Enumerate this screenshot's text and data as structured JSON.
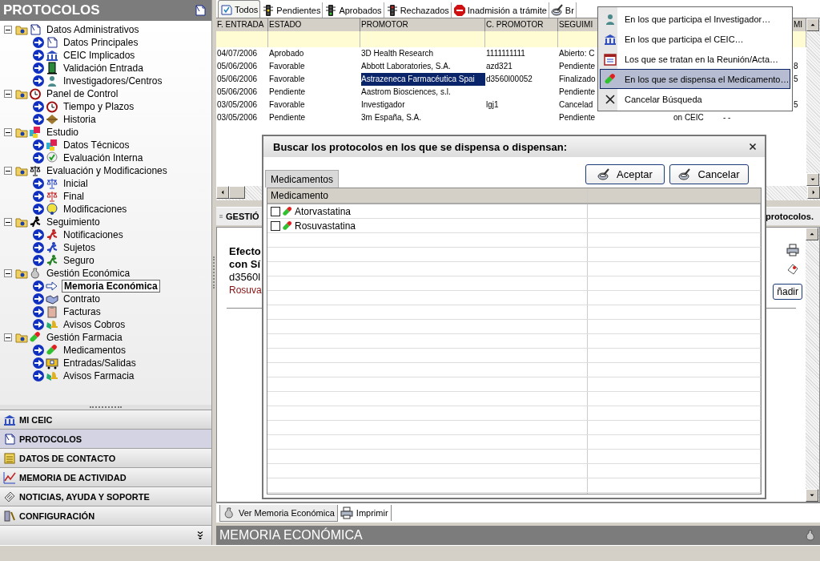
{
  "sidebar": {
    "title": "PROTOCOLOS",
    "tree": [
      {
        "label": "Datos Administrativos",
        "expanded": true,
        "children": [
          {
            "label": "Datos Principales",
            "selected": false
          },
          {
            "label": "CEIC Implicados",
            "selected": false
          },
          {
            "label": "Validación Entrada",
            "selected": false
          },
          {
            "label": "Investigadores/Centros",
            "selected": false
          }
        ]
      },
      {
        "label": "Panel de Control",
        "expanded": true,
        "children": [
          {
            "label": "Tiempo y Plazos",
            "selected": false
          },
          {
            "label": "Historia",
            "selected": false
          }
        ]
      },
      {
        "label": "Estudio",
        "expanded": true,
        "children": [
          {
            "label": "Datos Técnicos",
            "selected": false
          },
          {
            "label": "Evaluación Interna",
            "selected": false
          }
        ]
      },
      {
        "label": "Evaluación y Modificaciones",
        "expanded": true,
        "children": [
          {
            "label": "Inicial",
            "selected": false
          },
          {
            "label": "Final",
            "selected": false
          },
          {
            "label": "Modificaciones",
            "selected": false
          }
        ]
      },
      {
        "label": "Seguimiento",
        "expanded": true,
        "children": [
          {
            "label": "Notificaciones",
            "selected": false
          },
          {
            "label": "Sujetos",
            "selected": false
          },
          {
            "label": "Seguro",
            "selected": false
          }
        ]
      },
      {
        "label": "Gestión Económica",
        "expanded": true,
        "children": [
          {
            "label": "Memoria Económica",
            "selected": true
          },
          {
            "label": "Contrato",
            "selected": false
          },
          {
            "label": "Facturas",
            "selected": false
          },
          {
            "label": "Avisos Cobros",
            "selected": false
          }
        ]
      },
      {
        "label": "Gestión Farmacia",
        "expanded": true,
        "children": [
          {
            "label": "Medicamentos",
            "selected": false
          },
          {
            "label": "Entradas/Salidas",
            "selected": false
          },
          {
            "label": "Avisos Farmacia",
            "selected": false
          }
        ]
      }
    ],
    "nav": [
      {
        "label": "MI CEIC",
        "selected": false
      },
      {
        "label": "PROTOCOLOS",
        "selected": true
      },
      {
        "label": "DATOS DE CONTACTO",
        "selected": false
      },
      {
        "label": "MEMORIA DE ACTIVIDAD",
        "selected": false
      },
      {
        "label": "NOTICIAS, AYUDA Y SOPORTE",
        "selected": false
      },
      {
        "label": "CONFIGURACIÓN",
        "selected": false
      }
    ]
  },
  "tabs": [
    {
      "label": "Todos",
      "selected": true
    },
    {
      "label": "Pendientes",
      "selected": false
    },
    {
      "label": "Aprobados",
      "selected": false
    },
    {
      "label": "Rechazados",
      "selected": false
    },
    {
      "label": "Inadmisión a trámite",
      "selected": false
    },
    {
      "label": "Br",
      "selected": false
    }
  ],
  "table": {
    "columns": [
      {
        "label": "F. ENTRADA"
      },
      {
        "label": "ESTADO"
      },
      {
        "label": "PROMOTOR"
      },
      {
        "label": "C. PROMOTOR"
      },
      {
        "label": "SEGUIMI"
      },
      {},
      {},
      {
        "label": "MI"
      }
    ],
    "rows": [
      {
        "selected": false,
        "cells": [
          "04/07/2006",
          "Aprobado",
          "3D Health Research",
          "1111111111",
          "Abierto: C",
          null,
          null,
          null
        ]
      },
      {
        "selected": false,
        "cells": [
          "05/06/2006",
          "Favorable",
          "Abbott Laboratories, S.A.",
          "azd321",
          "Pendiente",
          null,
          null,
          "8"
        ]
      },
      {
        "selected": true,
        "cells": [
          "05/06/2006",
          "Favorable",
          "Astrazeneca Farmacéutica Spai",
          "d3560l00052",
          "Finalizado",
          null,
          null,
          "5"
        ]
      },
      {
        "selected": false,
        "cells": [
          "05/06/2006",
          "Pendiente",
          "Aastrom Biosciences, s.l.",
          null,
          "Pendiente",
          null,
          null,
          null
        ]
      },
      {
        "selected": false,
        "cells": [
          "03/05/2006",
          "Favorable",
          "Investigador",
          "lgj1",
          "Cancelad",
          null,
          null,
          "5"
        ]
      },
      {
        "selected": false,
        "cells": [
          "03/05/2006",
          "Pendiente",
          "3m España, S.A.",
          null,
          "Pendiente",
          "on CEIC",
          "-   -",
          null
        ]
      }
    ]
  },
  "section_bar": {
    "title": "GESTIÓ",
    "note": "protocolos."
  },
  "detail": {
    "lines": [
      {
        "kind": "title",
        "text": "Efecto"
      },
      {
        "kind": "title",
        "text": "con Sí"
      },
      {
        "kind": "code",
        "text": "d3560l"
      },
      {
        "kind": "drug",
        "text": "Rosuva"
      }
    ],
    "button": "ñadir"
  },
  "bottom_tabs": [
    {
      "label": "Ver Memoria Económica",
      "selected": true
    },
    {
      "label": "Imprimir",
      "selected": false
    }
  ],
  "footer_title": "MEMORIA ECONÓMICA",
  "menu": {
    "items": [
      {
        "label": "En los que participa el Investigador…",
        "selected": false
      },
      {
        "label": "En los que participa el CEIC…",
        "selected": false
      },
      {
        "label": "Los que se tratan en la Reunión/Acta…",
        "selected": false
      },
      {
        "label": "En los que se dispensa el Medicamento…",
        "selected": true
      },
      {
        "label": "Cancelar Búsqueda",
        "selected": false
      }
    ]
  },
  "dialog": {
    "title": "Buscar los protocolos en los que se dispensa o dispensan:",
    "tabs": [
      {
        "label": "Medicamentos",
        "selected": true
      }
    ],
    "buttons": [
      "Aceptar",
      "Cancelar"
    ],
    "columns": [
      "Medicamento"
    ],
    "rows": [
      {
        "name": "Atorvastatina",
        "checked": false
      },
      {
        "name": "Rosuvastatina",
        "checked": false
      }
    ]
  }
}
